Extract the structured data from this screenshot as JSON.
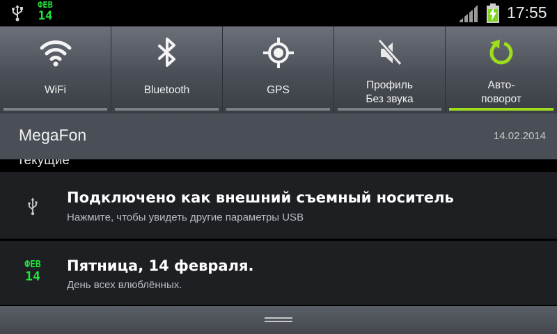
{
  "status_bar": {
    "usb_icon": "usb-icon",
    "calendar": {
      "month": "ФЕВ",
      "day": "14"
    },
    "signal_icon": "signal-icon",
    "battery_icon": "battery-charging-icon",
    "time": "17:55"
  },
  "quick_settings": {
    "tiles": [
      {
        "label": "WiFi",
        "icon": "wifi-icon",
        "active": false
      },
      {
        "label": "Bluetooth",
        "icon": "bluetooth-icon",
        "active": false
      },
      {
        "label": "GPS",
        "icon": "gps-icon",
        "active": false
      },
      {
        "label_line1": "Профиль",
        "label_line2": "Без звука",
        "icon": "silent-profile-icon",
        "active": false
      },
      {
        "label_line1": "Авто-",
        "label_line2": "поворот",
        "icon": "auto-rotate-icon",
        "active": true
      }
    ],
    "active_color": "#9edc1e"
  },
  "carrier": {
    "name": "MegaFon",
    "date": "14.02.2014"
  },
  "section": {
    "label": "Текущие"
  },
  "notifications": [
    {
      "icon": "usb-icon",
      "title": "Подключено как внешний съемный носитель",
      "subtitle": "Нажмите, чтобы увидеть другие параметры USB"
    },
    {
      "icon": "calendar-icon",
      "calendar": {
        "month": "ФЕВ",
        "day": "14"
      },
      "title": "Пятница, 14 февраля.",
      "subtitle": "День всех влюблённых."
    }
  ],
  "handle_icon": "drag-handle-icon",
  "colors": {
    "calendar_green": "#22e53a",
    "panel_bg": "#4a4e56",
    "notification_bg": "#1d1f23"
  }
}
